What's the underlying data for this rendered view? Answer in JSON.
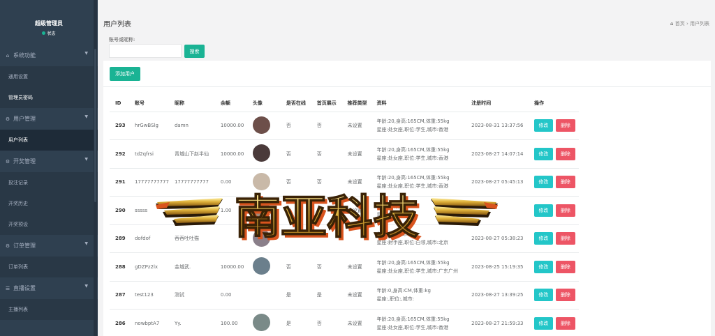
{
  "sidebar": {
    "admin_name": "超级管理员",
    "status": "状态",
    "groups": [
      {
        "label": "系统功能",
        "icon": "home-icon",
        "items": [
          {
            "label": "通用设置",
            "active": false,
            "white": false
          },
          {
            "label": "管理员密码",
            "active": false,
            "white": true
          }
        ]
      },
      {
        "label": "用户管理",
        "icon": "gear-icon",
        "items": [
          {
            "label": "用户列表",
            "active": true,
            "white": true
          }
        ]
      },
      {
        "label": "开奖管理",
        "icon": "gear-icon",
        "items": [
          {
            "label": "投注记录",
            "active": false,
            "white": false
          },
          {
            "label": "开奖历史",
            "active": false,
            "white": false
          },
          {
            "label": "开奖预设",
            "active": false,
            "white": false
          }
        ]
      },
      {
        "label": "订单管理",
        "icon": "gear-icon",
        "items": [
          {
            "label": "订单列表",
            "active": false,
            "white": false
          }
        ]
      },
      {
        "label": "直播设置",
        "icon": "list-icon",
        "items": [
          {
            "label": "主播列表",
            "active": false,
            "white": false
          }
        ]
      }
    ]
  },
  "header": {
    "title": "用户列表",
    "breadcrumb_home": "首页",
    "breadcrumb_current": "用户列表"
  },
  "search": {
    "label": "账号或昵称:",
    "value": "",
    "button": "搜索"
  },
  "toolbar": {
    "add_label": "添加用户"
  },
  "table": {
    "columns": [
      "ID",
      "账号",
      "昵称",
      "余额",
      "头像",
      "是否在线",
      "首页展示",
      "推荐类型",
      "资料",
      "注册时间",
      "操作"
    ],
    "edit_label": "修改",
    "delete_label": "删除",
    "rows": [
      {
        "id": "293",
        "account": "hrGwBSlg",
        "nickname": "damn",
        "balance": "10000.00",
        "avatar_color": "#6d4f4a",
        "online": "否",
        "home": "否",
        "recommend": "未设置",
        "info1": "年龄:20,身高:165CM,体重:55kg",
        "info2": "星座:处女座,职位:学生,城市:香港",
        "reg": "2023-08-31 13:37:56"
      },
      {
        "id": "292",
        "account": "td2qfrsi",
        "nickname": "青城山下赵半仙",
        "balance": "10000.00",
        "avatar_color": "#4a3a3a",
        "online": "否",
        "home": "否",
        "recommend": "未设置",
        "info1": "年龄:20,身高:165CM,体重:55kg",
        "info2": "星座:处女座,职位:学生,城市:香港",
        "reg": "2023-08-27 14:07:14"
      },
      {
        "id": "291",
        "account": "17777777777",
        "nickname": "17777777777",
        "balance": "0.00",
        "avatar_color": "#c9b9a8",
        "online": "否",
        "home": "否",
        "recommend": "未设置",
        "info1": "年龄:20,身高:165CM,体重:55kg",
        "info2": "星座:处女座,职位:学生,城市:香港",
        "reg": "2023-08-27 05:45:13"
      },
      {
        "id": "290",
        "account": "sssss",
        "nickname": "",
        "balance": "1.00",
        "avatar_color": "#a08a7a",
        "online": "否",
        "home": "否",
        "recommend": "未设置",
        "info1": "年龄:22,身高:",
        "info2": "星座:处女座",
        "reg": ""
      },
      {
        "id": "289",
        "account": "dofdof",
        "nickname": "吞吞吐吐猫",
        "balance": "",
        "avatar_color": "#8a7f8a",
        "online": "",
        "home": "",
        "recommend": "",
        "info1": "年龄:22,身高:",
        "info2": "星座:射手座,职位:白领,城市:北京",
        "reg": "2023-08-27 05:38:23"
      },
      {
        "id": "288",
        "account": "gDZPz2lx",
        "nickname": "金城武.",
        "balance": "10000.00",
        "avatar_color": "#6b7f8c",
        "online": "否",
        "home": "否",
        "recommend": "未设置",
        "info1": "年龄:20,身高:165CM,体重:55kg",
        "info2": "星座:处女座,职位:学生,城市:广东广州",
        "reg": "2023-08-25 15:19:35"
      },
      {
        "id": "287",
        "account": "test123",
        "nickname": "测试",
        "balance": "0.00",
        "avatar_color": "#ffffff",
        "online": "是",
        "home": "是",
        "recommend": "未设置",
        "info1": "年龄:0,身高:CM,体重:kg",
        "info2": "星座:,职位:,城市:",
        "reg": "2023-08-27 13:39:25"
      },
      {
        "id": "286",
        "account": "nowbptA7",
        "nickname": "Yy.",
        "balance": "100.00",
        "avatar_color": "#7a8a88",
        "online": "是",
        "home": "否",
        "recommend": "未设置",
        "info1": "年龄:20,身高:165CM,体重:55kg",
        "info2": "星座:处女座,职位:学生,城市:香港",
        "reg": "2023-08-27 21:59:33"
      }
    ]
  },
  "watermark": {
    "text": "南亚科技"
  }
}
